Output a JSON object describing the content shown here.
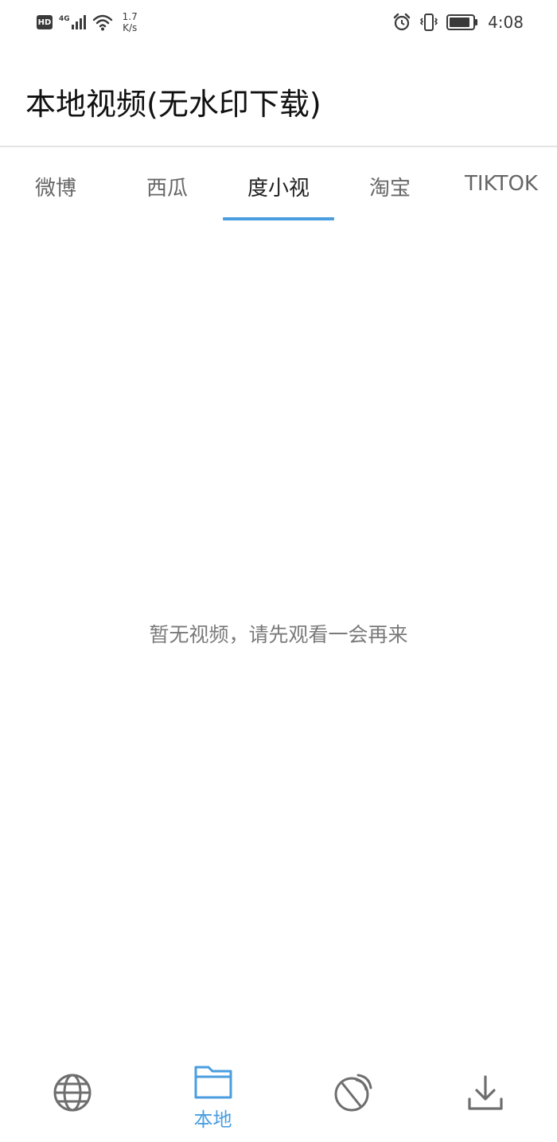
{
  "status_bar": {
    "hd_badge": "HD",
    "network_type": "4G",
    "net_speed_value": "1.7",
    "net_speed_unit": "K/s",
    "time": "4:08",
    "icons": [
      "hd-badge",
      "signal-icon",
      "wifi-icon",
      "alarm-icon",
      "vibrate-icon",
      "battery-icon"
    ]
  },
  "header": {
    "title": "本地视频(无水印下载)"
  },
  "tabs": [
    {
      "label": "微博",
      "active": false
    },
    {
      "label": "西瓜",
      "active": false
    },
    {
      "label": "度小视",
      "active": true
    },
    {
      "label": "淘宝",
      "active": false
    },
    {
      "label": "TIKTOK",
      "active": false
    }
  ],
  "main": {
    "empty_message": "暂无视频，请先观看一会再来"
  },
  "bottom_nav": {
    "items": [
      {
        "icon": "globe-icon",
        "label": "",
        "active": false
      },
      {
        "icon": "folder-icon",
        "label": "本地",
        "active": true
      },
      {
        "icon": "satellite-dish-icon",
        "label": "",
        "active": false
      },
      {
        "icon": "download-icon",
        "label": "",
        "active": false
      }
    ]
  },
  "colors": {
    "accent": "#4a9ee0",
    "tab_inactive": "#666666",
    "tab_active": "#1f1f1f",
    "icon_gray": "#6e6e6e",
    "empty_text": "#7a7a7a"
  }
}
